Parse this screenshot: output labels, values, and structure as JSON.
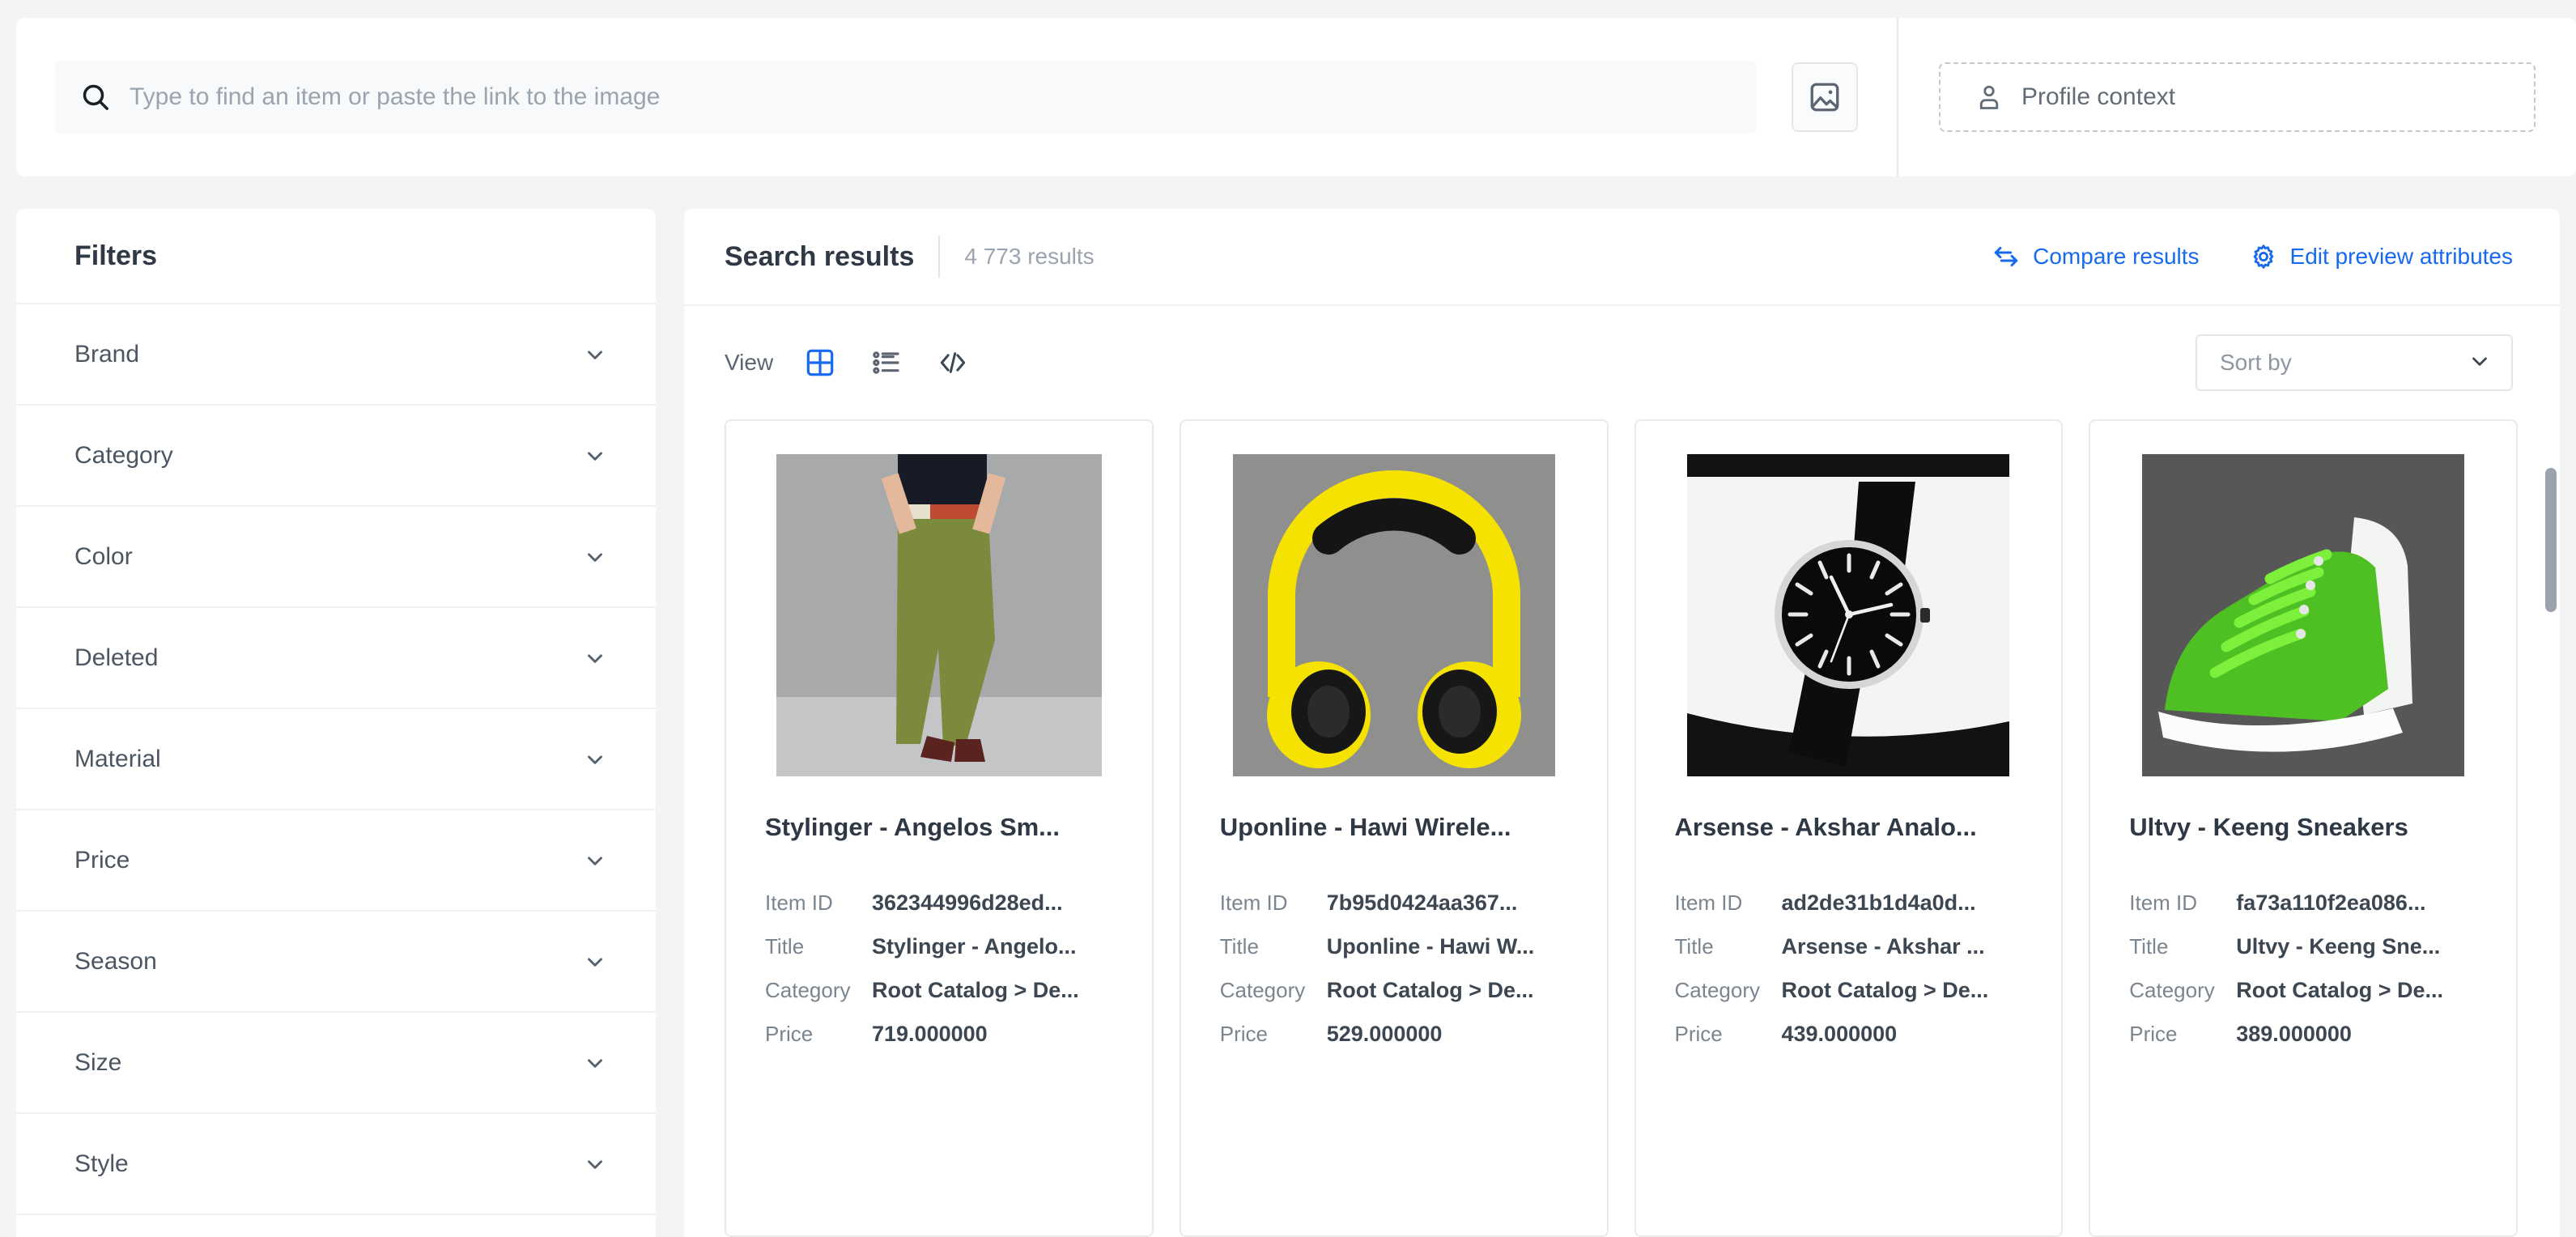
{
  "search": {
    "placeholder": "Type to find an item or paste the link to the image",
    "value": "",
    "icon": "search-icon",
    "upload_icon": "image-icon"
  },
  "profile_context": {
    "label": "Profile context",
    "icon": "user-icon"
  },
  "sidebar": {
    "title": "Filters",
    "items": [
      {
        "label": "Brand",
        "icon": "chevron-down-icon"
      },
      {
        "label": "Category",
        "icon": "chevron-down-icon"
      },
      {
        "label": "Color",
        "icon": "chevron-down-icon"
      },
      {
        "label": "Deleted",
        "icon": "chevron-down-icon"
      },
      {
        "label": "Material",
        "icon": "chevron-down-icon"
      },
      {
        "label": "Price",
        "icon": "chevron-down-icon"
      },
      {
        "label": "Season",
        "icon": "chevron-down-icon"
      },
      {
        "label": "Size",
        "icon": "chevron-down-icon"
      },
      {
        "label": "Style",
        "icon": "chevron-down-icon"
      }
    ]
  },
  "results_header": {
    "title": "Search results",
    "count": "4 773 results",
    "compare_label": "Compare results",
    "compare_icon": "compare-arrows-icon",
    "edit_label": "Edit preview attributes",
    "edit_icon": "gear-icon",
    "link_color": "#1769f0"
  },
  "toolbar": {
    "view_label": "View",
    "views": [
      {
        "name": "grid-view",
        "icon": "grid-icon",
        "active": true
      },
      {
        "name": "list-view",
        "icon": "list-icon",
        "active": false
      },
      {
        "name": "code-view",
        "icon": "code-icon",
        "active": false
      }
    ],
    "sort_placeholder": "Sort by",
    "sort_value": "",
    "sort_icon": "chevron-down-icon",
    "active_color": "#1769f0"
  },
  "attribute_labels": {
    "item_id": "Item ID",
    "title": "Title",
    "category": "Category",
    "price": "Price"
  },
  "products": [
    {
      "name": "Stylinger - Angelos Sm...",
      "image": "olive-trousers-photo",
      "item_id": "362344996d28ed...",
      "title": "Stylinger - Angelo...",
      "category": "Root Catalog > De...",
      "price": "719.000000"
    },
    {
      "name": "Uponline - Hawi Wirele...",
      "image": "yellow-headphones-photo",
      "item_id": "7b95d0424aa367...",
      "title": "Uponline - Hawi W...",
      "category": "Root Catalog > De...",
      "price": "529.000000"
    },
    {
      "name": "Arsense - Akshar Analo...",
      "image": "black-watch-photo",
      "item_id": "ad2de31b1d4a0d...",
      "title": "Arsense - Akshar ...",
      "category": "Root Catalog > De...",
      "price": "439.000000"
    },
    {
      "name": "Ultvy - Keeng Sneakers",
      "image": "green-sneaker-photo",
      "item_id": "fa73a110f2ea086...",
      "title": "Ultvy - Keeng Sne...",
      "category": "Root Catalog > De...",
      "price": "389.000000"
    }
  ]
}
